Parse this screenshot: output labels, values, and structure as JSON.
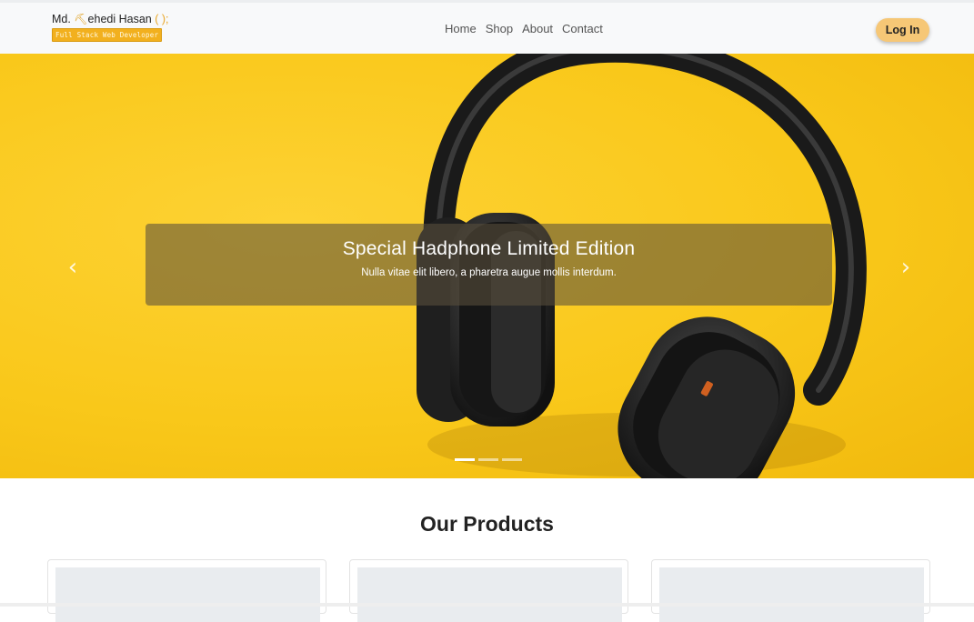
{
  "brand": {
    "name_prefix": "Md. ",
    "name_rest": "ehedi Hasan",
    "name_suffix": " ( );",
    "tagline": "Full Stack Web Developer"
  },
  "nav": {
    "links": [
      "Home",
      "Shop",
      "About",
      "Contact"
    ],
    "login_label": "Log In"
  },
  "hero": {
    "title": "Special Hadphone Limited Edition",
    "subtitle": "Nulla vitae elit libero, a pharetra augue mollis interdum.",
    "prev_icon": "chevron-left-icon",
    "next_icon": "chevron-right-icon",
    "slide_count": 3,
    "active_slide": 1
  },
  "products": {
    "title": "Our Products",
    "cards": 3
  },
  "colors": {
    "hero_yellow": "#f9c81a",
    "login_bg": "#f6c776",
    "brand_tag": "#f2b01e"
  }
}
